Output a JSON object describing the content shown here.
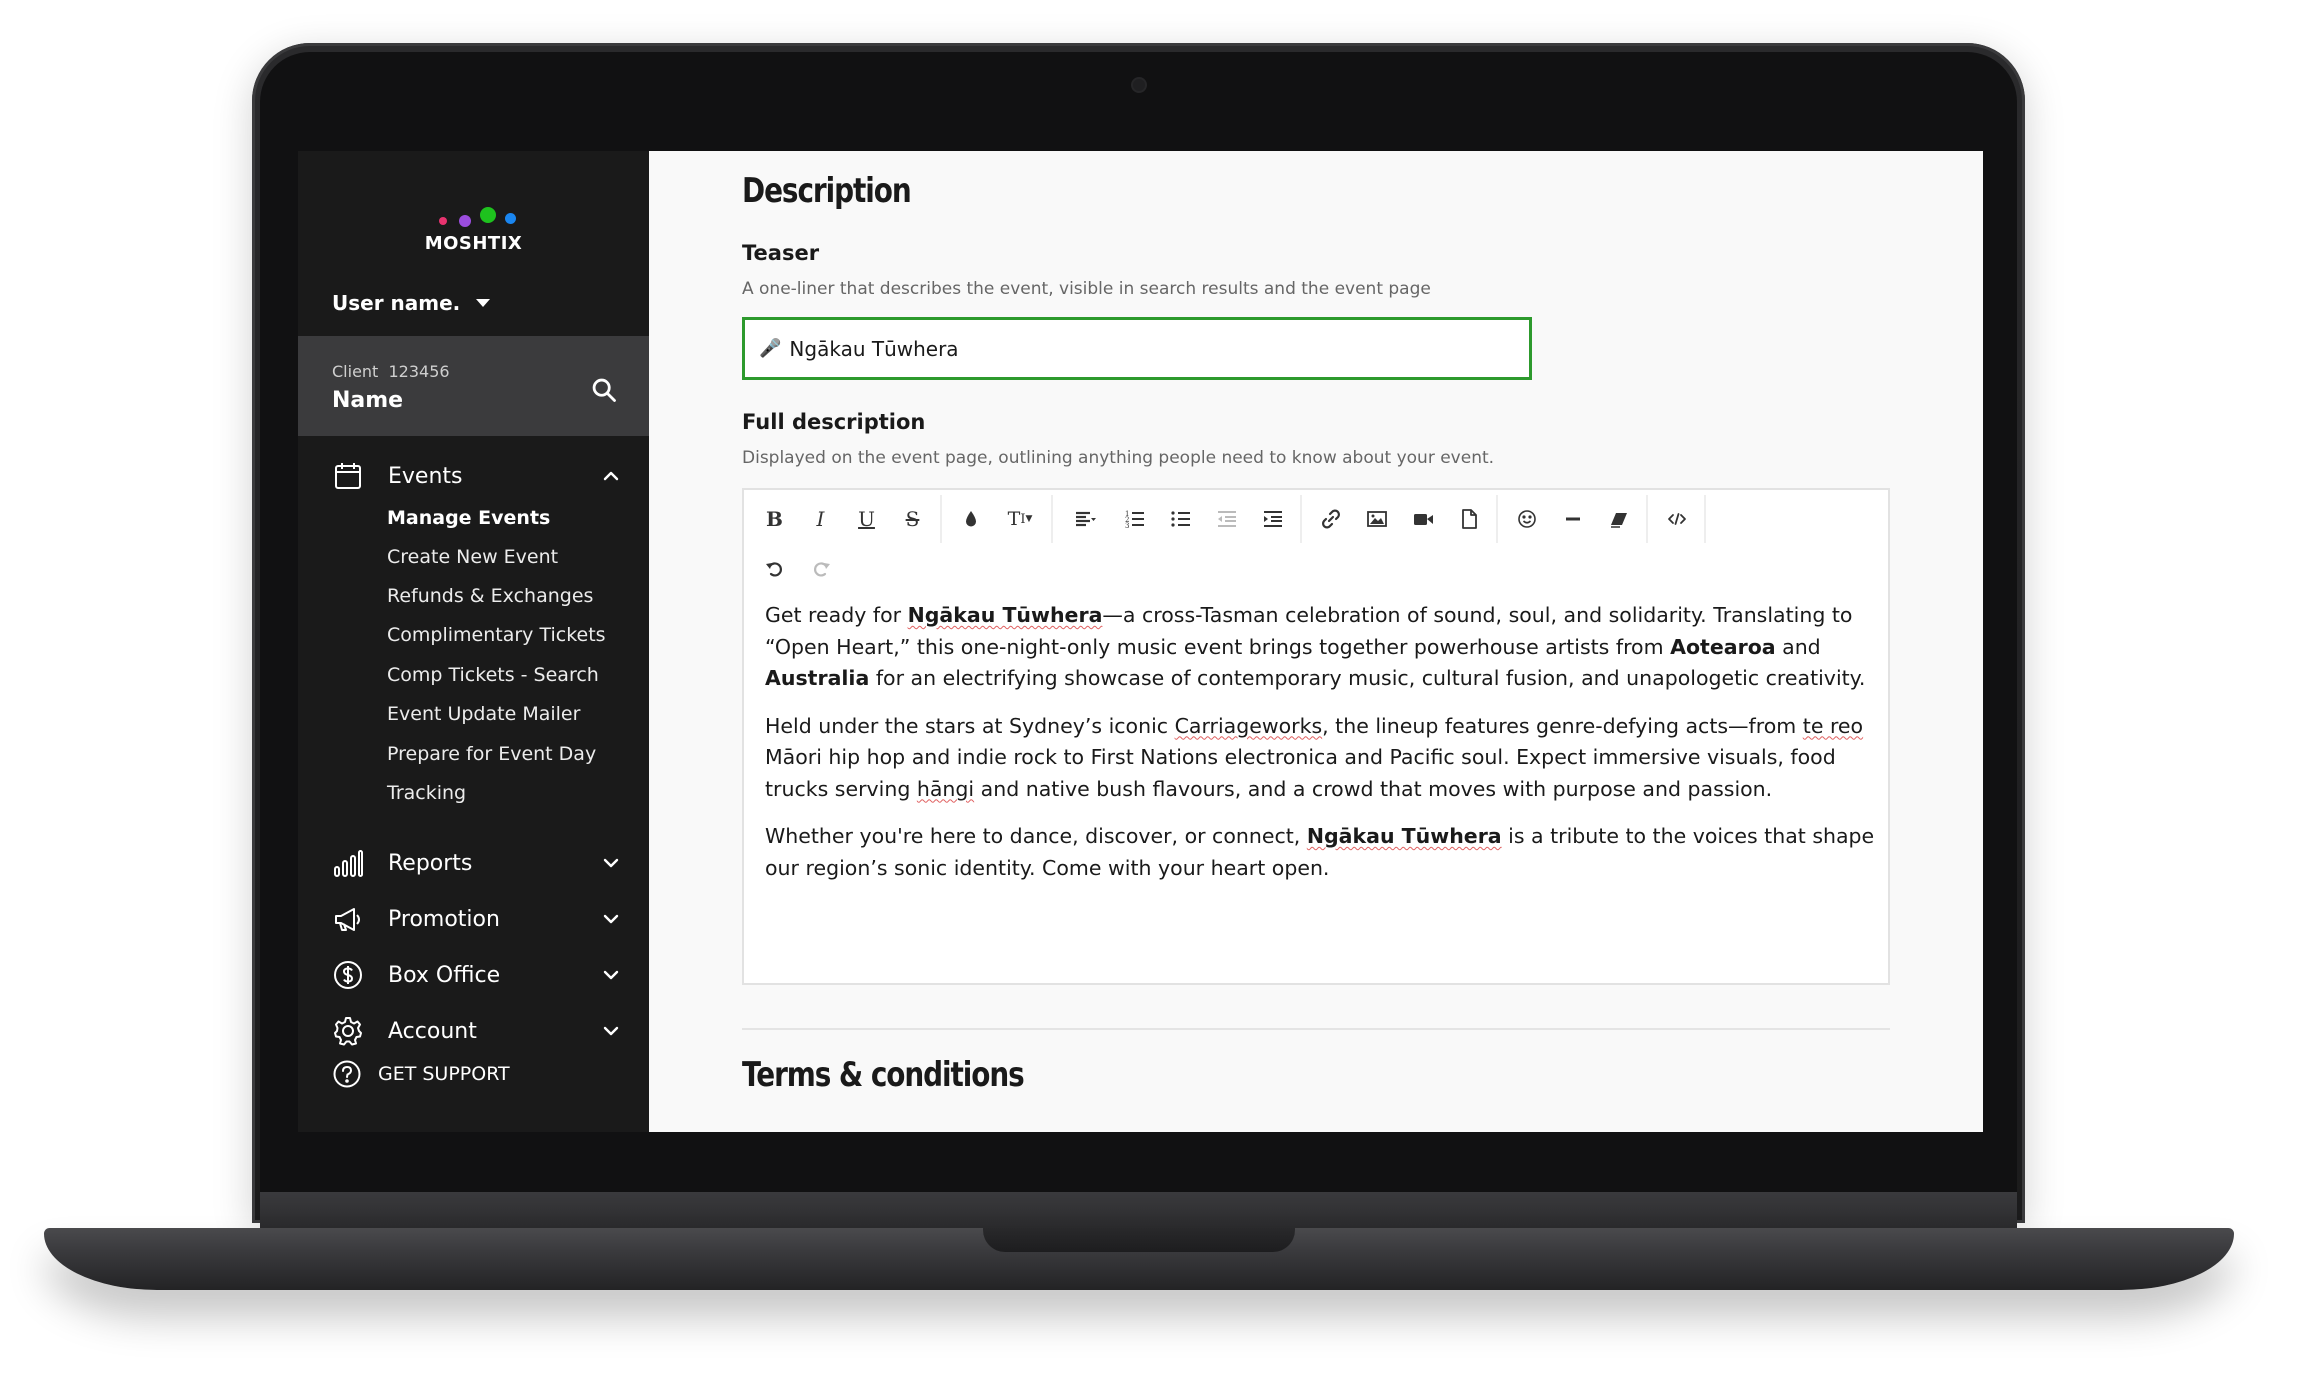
{
  "brand": {
    "logo_text": "MOSHTIX",
    "dot_colors": [
      "#e8336f",
      "#9b4dde",
      "#1ec21e",
      "#1a86f0"
    ]
  },
  "sidebar": {
    "user_name": "User name.",
    "client_label": "Client  123456",
    "client_name": "Name",
    "events": {
      "label": "Events",
      "sub_items": [
        "Manage Events",
        "Create New Event",
        "Refunds & Exchanges",
        "Complimentary Tickets",
        "Comp Tickets - Search",
        "Event Update Mailer",
        "Prepare for Event Day",
        "Tracking"
      ]
    },
    "reports": "Reports",
    "promotion": "Promotion",
    "box_office": "Box Office",
    "account": "Account",
    "support": "GET SUPPORT"
  },
  "main": {
    "description_title": "Description",
    "teaser_label": "Teaser",
    "teaser_help": "A one-liner that describes the event, visible in search results and the event page",
    "teaser_value": "Ngākau Tūwhera",
    "full_label": "Full description",
    "full_help": "Displayed on the event page, outlining anything people need to know about your event.",
    "terms_title": "Terms & conditions",
    "editor": {
      "p1": {
        "a": "Get ready for ",
        "b": "Ngākau Tūwhera",
        "c": "—a cross-Tasman celebration of sound, soul, and solidarity. Translating to “Open Heart,” this one-night-only music event brings together powerhouse artists from ",
        "d": "Aotearoa",
        "e": " and ",
        "f": "Australia",
        "g": " for an electrifying showcase of contemporary music, cultural fusion, and unapologetic creativity."
      },
      "p2": {
        "a": "Held under the stars at Sydney’s iconic ",
        "b": "Carriageworks",
        "c": ", the lineup features genre-defying acts—from ",
        "d": "te reo",
        "e": " Māori hip hop and indie rock to First Nations electronica and Pacific soul. Expect immersive visuals, food trucks serving ",
        "f": "hāngi",
        "g": " and native bush flavours, and a crowd that moves with purpose and passion."
      },
      "p3": {
        "a": "Whether you're here to dance, discover, or connect, ",
        "b": "Ngākau Tūwhera",
        "c": " is a tribute to the voices that shape our region’s sonic identity. Come with your heart open."
      }
    }
  },
  "colors": {
    "sidebar_bg": "#1a1a1a",
    "client_box_bg": "#3b3b3d",
    "focus_border": "#2d9a2d"
  }
}
